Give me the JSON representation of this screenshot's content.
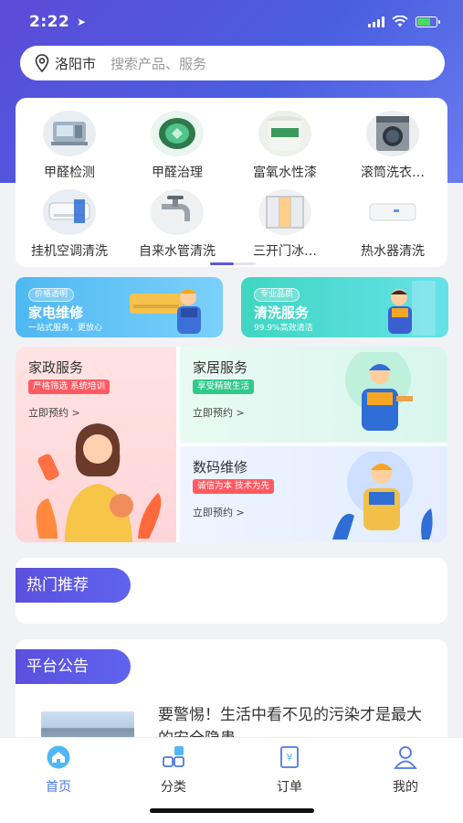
{
  "status_bar": {
    "time": "2:22"
  },
  "search": {
    "city": "洛阳市",
    "placeholder": "搜索产品、服务"
  },
  "categories": [
    {
      "label": "甲醛检测",
      "icon": "formaldehyde-test-icon"
    },
    {
      "label": "甲醛治理",
      "icon": "formaldehyde-treatment-icon"
    },
    {
      "label": "富氧水性漆",
      "icon": "paint-bucket-icon"
    },
    {
      "label": "滚筒洗衣…",
      "icon": "washing-machine-icon"
    },
    {
      "label": "挂机空调清洗",
      "icon": "air-conditioner-icon"
    },
    {
      "label": "自来水管清洗",
      "icon": "faucet-icon"
    },
    {
      "label": "三开门冰…",
      "icon": "refrigerator-icon"
    },
    {
      "label": "热水器清洗",
      "icon": "water-heater-icon"
    }
  ],
  "banners": [
    {
      "tag": "价格透明",
      "title": "家电维修",
      "subtitle": "一站式服务，更放心"
    },
    {
      "tag": "专业品质",
      "title": "清洗服务",
      "subtitle": "99.9%高效清洁"
    }
  ],
  "services": {
    "housekeeping": {
      "title": "家政服务",
      "tag": "严格筛选 系统培训",
      "action": "立即预约 >"
    },
    "home": {
      "title": "家居服务",
      "tag": "享受精致生活",
      "action": "立即预约 >"
    },
    "digital": {
      "title": "数码维修",
      "tag": "诚信为本 技术为先",
      "action": "立即预约 >"
    }
  },
  "hot": {
    "title": "热门推荐"
  },
  "notice": {
    "title": "平台公告",
    "article": "要警惕！生活中看不见的污染才是最大的安全隐患"
  },
  "tabs": [
    {
      "label": "首页",
      "icon": "home-icon",
      "active": true
    },
    {
      "label": "分类",
      "icon": "category-icon"
    },
    {
      "label": "订单",
      "icon": "order-icon"
    },
    {
      "label": "我的",
      "icon": "profile-icon"
    }
  ],
  "colors": {
    "primary": "#5b50de",
    "tab_active": "#4a78e8"
  }
}
